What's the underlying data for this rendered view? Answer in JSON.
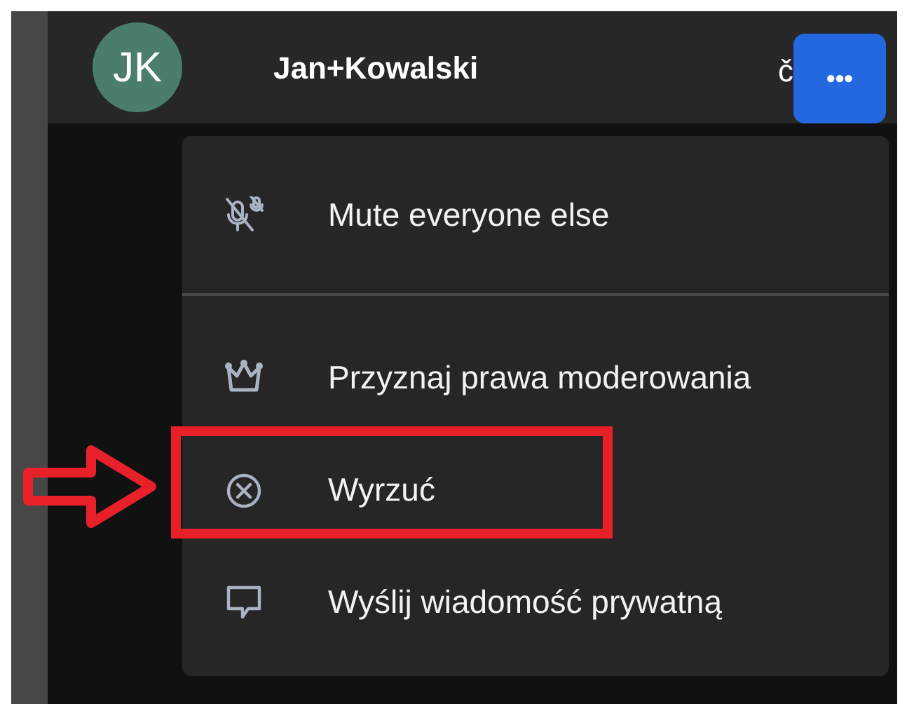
{
  "participant": {
    "initials": "JK",
    "name": "Jan+Kowalski",
    "trailing_text": "č"
  },
  "more_button": {
    "label": "•••"
  },
  "menu": {
    "items": [
      {
        "kind": "mute",
        "label": "Mute everyone else",
        "highlighted": false
      },
      {
        "kind": "crown",
        "label": "Przyznaj prawa moderowania",
        "highlighted": false
      },
      {
        "kind": "kick",
        "label": "Wyrzuć",
        "highlighted": true
      },
      {
        "kind": "message",
        "label": "Wyślij wiadomość prywatną",
        "highlighted": false
      }
    ]
  }
}
